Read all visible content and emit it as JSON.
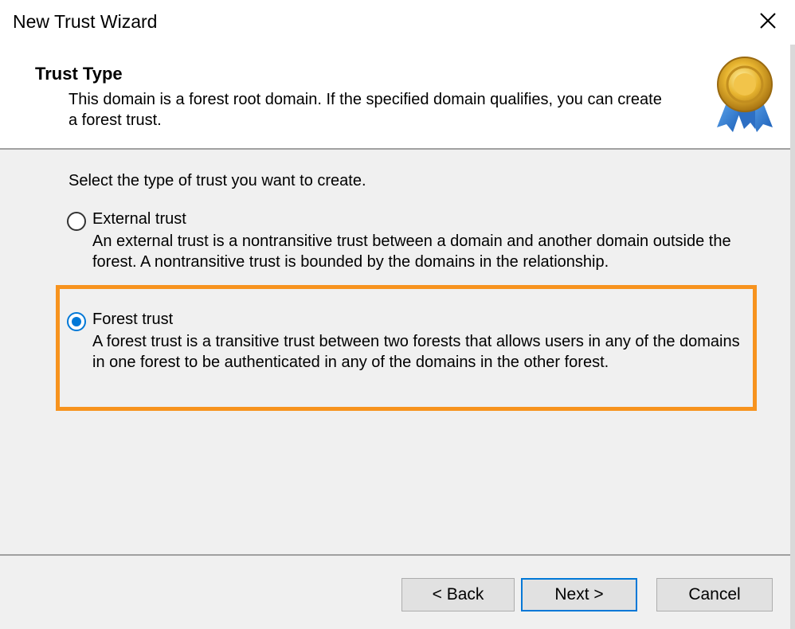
{
  "window": {
    "title": "New Trust Wizard",
    "close_icon": "close-icon"
  },
  "header": {
    "heading": "Trust Type",
    "subtext": "This domain is a forest root domain. If the specified domain qualifies, you can create a forest trust.",
    "badge_icon": "award-ribbon-icon"
  },
  "content": {
    "prompt": "Select the type of trust you want to create.",
    "options": [
      {
        "label": "External trust",
        "description": "An external trust is a nontransitive trust between a domain and another domain outside the forest. A nontransitive trust is bounded by the domains in the relationship.",
        "selected": false
      },
      {
        "label": "Forest trust",
        "description": "A forest trust is a transitive trust between two forests that allows users in any of the domains in one forest to be authenticated in any of the domains in the other forest.",
        "selected": true
      }
    ],
    "highlight_color": "#f7931e",
    "accent_color": "#0078d7"
  },
  "footer": {
    "back_label": "< Back",
    "next_label": "Next >",
    "cancel_label": "Cancel"
  }
}
